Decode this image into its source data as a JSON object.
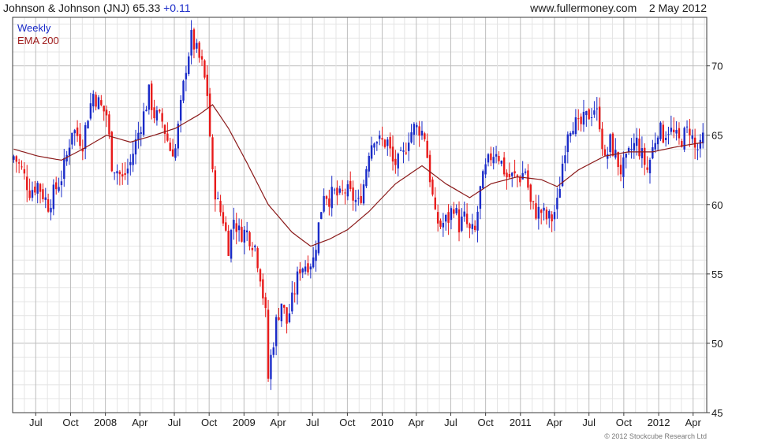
{
  "header": {
    "ticker_text": "Johnson & Johnson (JNJ) 65.33",
    "change_text": "+0.11",
    "source": "www.fullermoney.com",
    "date": "2 May 2012"
  },
  "legend": {
    "weekly": "Weekly",
    "ema": "EMA 200"
  },
  "copyright": "© 2012 Stockcube Research Ltd",
  "colors": {
    "up": "#1a2bc8",
    "down": "#e81a1a",
    "ema": "#8b1a1a",
    "grid": "#c8c8c8",
    "frame": "#3a3a3a"
  },
  "chart_data": {
    "type": "candlestick",
    "interval": "Weekly",
    "ylim": [
      45,
      73.5
    ],
    "y_ticks": [
      "45",
      "50",
      "55",
      "60",
      "65",
      "70"
    ],
    "x_ticks": [
      "Jul",
      "Oct",
      "2008",
      "Apr",
      "Jul",
      "Oct",
      "2009",
      "Apr",
      "Jul",
      "Oct",
      "2010",
      "Apr",
      "Jul",
      "Oct",
      "2011",
      "Apr",
      "Jul",
      "Oct",
      "2012",
      "Apr"
    ],
    "close_anchors": [
      [
        "2007-05-04",
        63.5
      ],
      [
        "2007-05-25",
        62.5
      ],
      [
        "2007-06-15",
        61
      ],
      [
        "2007-07-06",
        61.5
      ],
      [
        "2007-08-03",
        60
      ],
      [
        "2007-09-07",
        62
      ],
      [
        "2007-09-21",
        63.5
      ],
      [
        "2007-10-05",
        65.5
      ],
      [
        "2007-10-19",
        65
      ],
      [
        "2007-11-02",
        64.5
      ],
      [
        "2007-11-16",
        66.5
      ],
      [
        "2007-11-30",
        68
      ],
      [
        "2007-12-21",
        67
      ],
      [
        "2008-01-04",
        66.5
      ],
      [
        "2008-01-18",
        63
      ],
      [
        "2008-02-01",
        62.5
      ],
      [
        "2008-02-15",
        61.8
      ],
      [
        "2008-03-07",
        63
      ],
      [
        "2008-03-21",
        64.5
      ],
      [
        "2008-04-11",
        66.5
      ],
      [
        "2008-04-25",
        68
      ],
      [
        "2008-05-09",
        66.5
      ],
      [
        "2008-05-30",
        66
      ],
      [
        "2008-06-20",
        64
      ],
      [
        "2008-07-04",
        64
      ],
      [
        "2008-07-18",
        67
      ],
      [
        "2008-08-01",
        70
      ],
      [
        "2008-08-15",
        72
      ],
      [
        "2008-08-29",
        71
      ],
      [
        "2008-09-12",
        70
      ],
      [
        "2008-09-26",
        68
      ],
      [
        "2008-10-10",
        62
      ],
      [
        "2008-10-24",
        60
      ],
      [
        "2008-11-07",
        59
      ],
      [
        "2008-11-21",
        57
      ],
      [
        "2008-12-05",
        59
      ],
      [
        "2008-12-19",
        58
      ],
      [
        "2009-01-09",
        58
      ],
      [
        "2009-01-30",
        57
      ],
      [
        "2009-02-13",
        55
      ],
      [
        "2009-02-27",
        52
      ],
      [
        "2009-03-06",
        47.5
      ],
      [
        "2009-03-13",
        49
      ],
      [
        "2009-03-27",
        51.5
      ],
      [
        "2009-04-10",
        53
      ],
      [
        "2009-04-24",
        51.5
      ],
      [
        "2009-05-08",
        53
      ],
      [
        "2009-05-29",
        55.5
      ],
      [
        "2009-06-19",
        55.8
      ],
      [
        "2009-07-03",
        56
      ],
      [
        "2009-07-17",
        58.5
      ],
      [
        "2009-07-31",
        61
      ],
      [
        "2009-08-14",
        60.5
      ],
      [
        "2009-08-28",
        60.8
      ],
      [
        "2009-09-11",
        60.5
      ],
      [
        "2009-09-25",
        61
      ],
      [
        "2009-10-16",
        60.5
      ],
      [
        "2009-10-30",
        60
      ],
      [
        "2009-11-13",
        61.5
      ],
      [
        "2009-11-27",
        64
      ],
      [
        "2009-12-11",
        65
      ],
      [
        "2009-12-25",
        64.5
      ],
      [
        "2010-01-15",
        64.5
      ],
      [
        "2010-01-29",
        63
      ],
      [
        "2010-02-12",
        63
      ],
      [
        "2010-02-26",
        63.5
      ],
      [
        "2010-03-12",
        65
      ],
      [
        "2010-03-26",
        65.5
      ],
      [
        "2010-04-09",
        65.5
      ],
      [
        "2010-04-23",
        65
      ],
      [
        "2010-05-07",
        62
      ],
      [
        "2010-05-21",
        59
      ],
      [
        "2010-06-04",
        58.5
      ],
      [
        "2010-06-25",
        59
      ],
      [
        "2010-07-09",
        60
      ],
      [
        "2010-07-23",
        58.5
      ],
      [
        "2010-08-06",
        59
      ],
      [
        "2010-08-20",
        58
      ],
      [
        "2010-09-03",
        58
      ],
      [
        "2010-09-17",
        61
      ],
      [
        "2010-10-01",
        62.5
      ],
      [
        "2010-10-15",
        63.5
      ],
      [
        "2010-10-29",
        64
      ],
      [
        "2010-11-12",
        63
      ],
      [
        "2010-11-26",
        62
      ],
      [
        "2010-12-10",
        62
      ],
      [
        "2010-12-31",
        62
      ],
      [
        "2011-01-14",
        62.5
      ],
      [
        "2011-01-28",
        60
      ],
      [
        "2011-02-11",
        59.5
      ],
      [
        "2011-02-25",
        59.5
      ],
      [
        "2011-03-11",
        59
      ],
      [
        "2011-03-25",
        59
      ],
      [
        "2011-04-08",
        60
      ],
      [
        "2011-04-22",
        63
      ],
      [
        "2011-05-06",
        65.5
      ],
      [
        "2011-05-20",
        66
      ],
      [
        "2011-06-03",
        65.5
      ],
      [
        "2011-06-17",
        66
      ],
      [
        "2011-07-01",
        66.5
      ],
      [
        "2011-07-15",
        67
      ],
      [
        "2011-07-29",
        66
      ],
      [
        "2011-08-12",
        63
      ],
      [
        "2011-08-26",
        64.5
      ],
      [
        "2011-09-09",
        63.5
      ],
      [
        "2011-09-23",
        62.5
      ],
      [
        "2011-10-07",
        63
      ],
      [
        "2011-10-21",
        64
      ],
      [
        "2011-11-04",
        64.5
      ],
      [
        "2011-11-18",
        63.5
      ],
      [
        "2011-12-02",
        62.5
      ],
      [
        "2011-12-16",
        64
      ],
      [
        "2011-12-30",
        65.5
      ],
      [
        "2012-01-13",
        65
      ],
      [
        "2012-01-27",
        65.5
      ],
      [
        "2012-02-10",
        65
      ],
      [
        "2012-02-24",
        64.5
      ],
      [
        "2012-03-09",
        65
      ],
      [
        "2012-03-23",
        65.5
      ],
      [
        "2012-04-06",
        64
      ],
      [
        "2012-04-20",
        64
      ],
      [
        "2012-05-02",
        65.33
      ]
    ],
    "ema_200_anchors": [
      [
        "2007-05-04",
        64
      ],
      [
        "2007-07-06",
        63.5
      ],
      [
        "2007-09-07",
        63.2
      ],
      [
        "2007-11-02",
        64
      ],
      [
        "2008-01-04",
        65
      ],
      [
        "2008-03-07",
        64.5
      ],
      [
        "2008-05-09",
        65
      ],
      [
        "2008-07-04",
        65.5
      ],
      [
        "2008-09-05",
        66.5
      ],
      [
        "2008-10-10",
        67.2
      ],
      [
        "2008-11-21",
        65.5
      ],
      [
        "2009-01-09",
        63
      ],
      [
        "2009-03-06",
        60
      ],
      [
        "2009-05-08",
        58
      ],
      [
        "2009-06-26",
        57
      ],
      [
        "2009-08-14",
        57.5
      ],
      [
        "2009-10-02",
        58.2
      ],
      [
        "2009-11-27",
        59.5
      ],
      [
        "2010-02-05",
        61.5
      ],
      [
        "2010-04-16",
        62.8
      ],
      [
        "2010-06-18",
        61.5
      ],
      [
        "2010-08-20",
        60.5
      ],
      [
        "2010-10-15",
        61.5
      ],
      [
        "2010-12-24",
        62
      ],
      [
        "2011-02-25",
        61.8
      ],
      [
        "2011-04-08",
        61.3
      ],
      [
        "2011-06-03",
        62.5
      ],
      [
        "2011-08-12",
        63.5
      ],
      [
        "2011-10-14",
        63.8
      ],
      [
        "2011-12-16",
        63.8
      ],
      [
        "2012-02-24",
        64.2
      ],
      [
        "2012-05-02",
        64.5
      ]
    ]
  }
}
